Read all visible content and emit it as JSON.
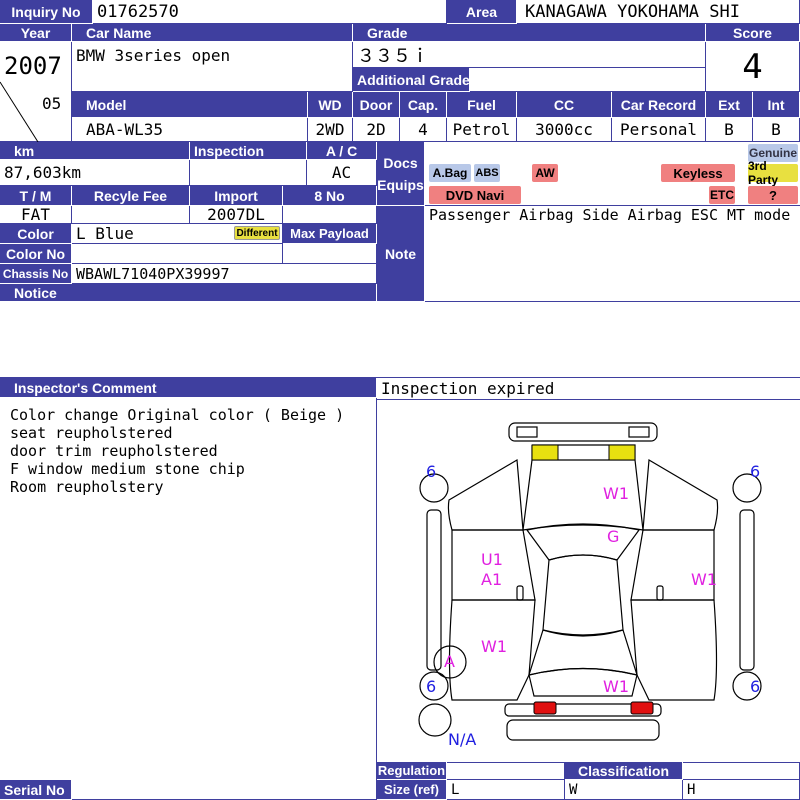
{
  "labels": {
    "inquiry_no": "Inquiry No",
    "area": "Area",
    "year": "Year",
    "car_name": "Car Name",
    "grade": "Grade",
    "score": "Score",
    "additional_grade": "Additional Grade",
    "model": "Model",
    "wd": "WD",
    "door": "Door",
    "cap": "Cap.",
    "fuel": "Fuel",
    "cc": "CC",
    "car_record": "Car Record",
    "ext": "Ext",
    "int": "Int",
    "km": "km",
    "inspection": "Inspection",
    "ac": "A / C",
    "docs": "Docs",
    "equips": "Equips",
    "tm": "T / M",
    "recycle_fee": "Recyle Fee",
    "import": "Import",
    "eight_no": "8 No",
    "color": "Color",
    "different": "Different",
    "max_payload": "Max Payload",
    "color_no": "Color No",
    "chassis_no": "Chassis No",
    "notice": "Notice",
    "note": "Note",
    "inspector_comment": "Inspector's Comment",
    "serial_no": "Serial No",
    "regulation": "Regulation",
    "classification": "Classification",
    "size_ref": "Size (ref)",
    "size_l": "L",
    "size_w": "W",
    "size_h": "H"
  },
  "values": {
    "inquiry_no": "01762570",
    "area": "KANAGAWA YOKOHAMA SHI",
    "year": "2007",
    "month": "05",
    "car_name": "BMW 3series open",
    "grade": "３３５ｉ",
    "score": "4",
    "model": "ABA-WL35",
    "wd": "2WD",
    "door": "2D",
    "cap": "4",
    "fuel": "Petrol",
    "cc": "3000cc",
    "car_record": "Personal",
    "ext": "B",
    "int": "B",
    "km": "87,603km",
    "inspection": "",
    "ac": "AC",
    "tm": "FAT",
    "recycle_fee": "",
    "import": "2007DL",
    "eight_no": "",
    "color": "L Blue",
    "max_payload": "",
    "color_no": "",
    "chassis_no": "WBAWL71040PX39997",
    "note": "Passenger Airbag Side Airbag ESC MT mode",
    "inspection_status": "Inspection expired"
  },
  "equips": {
    "genuine": "Genuine",
    "abag": "A.Bag",
    "abs": "ABS",
    "aw": "AW",
    "keyless": "Keyless",
    "third_party": "3rd Party",
    "dvd_navi": "DVD Navi",
    "etc": "ETC",
    "question": "?"
  },
  "inspector_comments": [
    "Color change Original color ( Beige )",
    "seat reupholstered",
    "door trim reupholstered",
    "F window medium stone chip",
    "Room reupholstery"
  ],
  "diagram_marks": {
    "tire_fl": "6",
    "tire_fr": "6",
    "tire_rl": "6",
    "tire_rr": "6",
    "hood": "W1",
    "windshield": "G",
    "left_front": "U1",
    "left_front2": "A1",
    "right_door": "W1",
    "left_rear": "W1",
    "left_rear_wheel": "A",
    "trunk": "W1",
    "spare": "N/A"
  },
  "colors": {
    "header_blue": "#3f3f9f",
    "damage_magenta": "#e020e0",
    "tire_blue": "#2020e0",
    "badge_blue": "#b8c8e8",
    "badge_red": "#f08080",
    "badge_yellow": "#e8e040"
  }
}
